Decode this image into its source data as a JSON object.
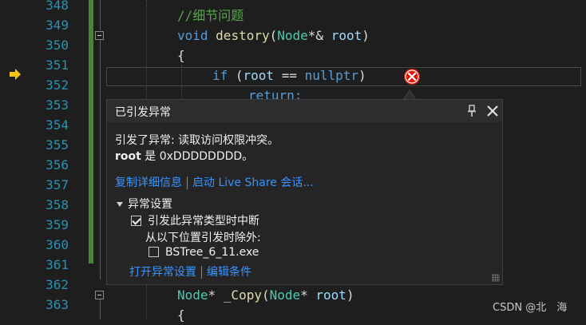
{
  "editor": {
    "line_numbers": [
      "348",
      "349",
      "350",
      "351",
      "352",
      "353",
      "354",
      "355",
      "356",
      "357",
      "358",
      "359",
      "360",
      "361",
      "362",
      "363"
    ],
    "code": {
      "l348_comment": "//细节问题",
      "l349_void": "void",
      "l349_fn": "destory",
      "l349_open": "(",
      "l349_type": "Node",
      "l349_mid": "*& ",
      "l349_param": "root",
      "l349_close": ")",
      "l350_brace": "{",
      "l351_if": "if",
      "l351_open": " (",
      "l351_var": "root",
      "l351_op": " == ",
      "l351_null": "nullptr",
      "l351_close": ")",
      "l352_return": "return;",
      "l362_type": "Node",
      "l362_star": "* ",
      "l362_fn": "_Copy",
      "l362_open": "(",
      "l362_type2": "Node",
      "l362_star2": "* ",
      "l362_param": "root",
      "l362_close": ")",
      "l363_brace": "{"
    }
  },
  "exception_popup": {
    "title": "已引发异常",
    "message": "引发了异常: 读取访问权限冲突。",
    "detail_var": "root",
    "detail_rest": " 是 0xDDDDDDDD。",
    "copy_details_link": "复制详细信息",
    "live_share_link": "启动 Live Share 会话...",
    "settings_header": "异常设置",
    "break_checkbox_label": "引发此异常类型时中断",
    "break_checked": true,
    "except_label": "从以下位置引发时除外:",
    "module_checkbox_label": "BSTree_6_11.exe",
    "module_checked": false,
    "open_settings_link": "打开异常设置",
    "edit_conditions_link": "编辑条件"
  },
  "watermark": "CSDN @北　海",
  "colors": {
    "line_number": "#2b91af",
    "keyword": "#569cd6",
    "type": "#4ec9b0",
    "function": "#dcdcaa",
    "variable": "#9cdcfe",
    "comment": "#57a64a",
    "link": "#3794ff",
    "error": "#e51400",
    "arrow": "#f5c518"
  },
  "icons": {
    "execution_pointer": "arrow-right-icon",
    "error": "error-circle-icon",
    "pin": "pin-icon",
    "close": "close-icon",
    "collapse": "triangle-down-icon",
    "resize": "resize-grip-icon"
  }
}
